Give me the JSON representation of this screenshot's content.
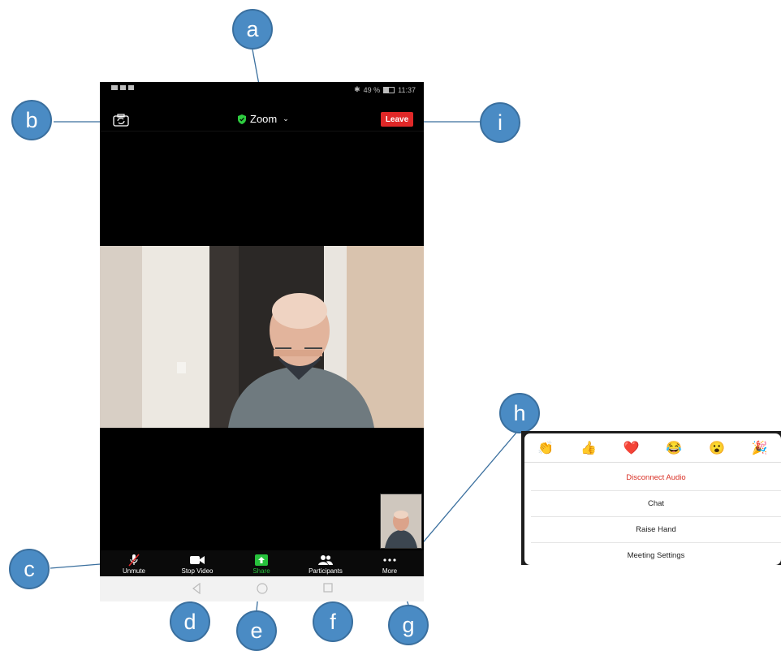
{
  "status_bar": {
    "battery_pct": "49 %",
    "time": "11:37"
  },
  "header": {
    "meeting_title": "Zoom",
    "leave_label": "Leave"
  },
  "toolbar": {
    "unmute": "Unmute",
    "stop_video": "Stop Video",
    "share": "Share",
    "participants": "Participants",
    "more": "More"
  },
  "more_menu": {
    "reactions": [
      "👏",
      "👍",
      "❤️",
      "😂",
      "😮",
      "🎉"
    ],
    "items": [
      "Disconnect Audio",
      "Chat",
      "Raise Hand",
      "Meeting Settings"
    ]
  },
  "callouts": {
    "a": "a",
    "b": "b",
    "c": "c",
    "d": "d",
    "e": "e",
    "f": "f",
    "g": "g",
    "h": "h",
    "i": "i"
  },
  "colors": {
    "leave": "#e02828",
    "share_green": "#27c13c",
    "callout_blue": "#4a8bc4",
    "danger_text": "#d93025"
  }
}
